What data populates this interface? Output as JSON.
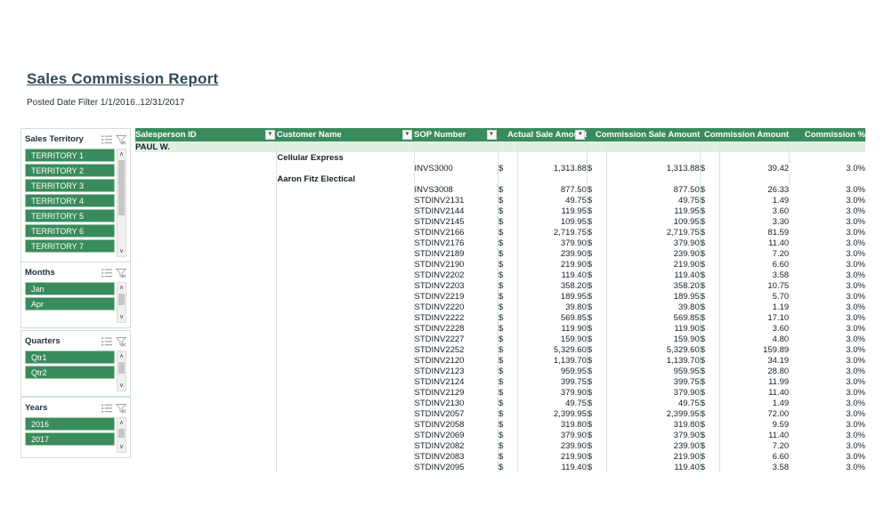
{
  "report": {
    "title": "Sales Commission Report",
    "subtitle": "Posted Date Filter 1/1/2016..12/31/2017"
  },
  "theme": {
    "accent_green": "#3a8b5c",
    "band_green": "#dff0e3",
    "title_color": "#2f4a5c"
  },
  "slicers": [
    {
      "title": "Sales Territory",
      "multiselect_icon": "multi-select-icon",
      "clear_filter_icon": "clear-filter-icon",
      "items": [
        "TERRITORY 1",
        "TERRITORY 2",
        "TERRITORY 3",
        "TERRITORY 4",
        "TERRITORY 5",
        "TERRITORY 6",
        "TERRITORY 7"
      ],
      "scroll_up": "∧",
      "scroll_down": "∨"
    },
    {
      "title": "Months",
      "multiselect_icon": "multi-select-icon",
      "clear_filter_icon": "clear-filter-icon",
      "items": [
        "Jan",
        "Apr"
      ],
      "scroll_up": "∧",
      "scroll_down": "∨"
    },
    {
      "title": "Quarters",
      "multiselect_icon": "multi-select-icon",
      "clear_filter_icon": "clear-filter-icon",
      "items": [
        "Qtr1",
        "Qtr2"
      ],
      "scroll_up": "∧",
      "scroll_down": "∨"
    },
    {
      "title": "Years",
      "multiselect_icon": "multi-select-icon",
      "clear_filter_icon": "clear-filter-icon",
      "items": [
        "2016",
        "2017"
      ],
      "scroll_up": "∧",
      "scroll_down": "∨"
    }
  ],
  "table": {
    "columns": [
      {
        "label": "Salesperson ID",
        "filter": true
      },
      {
        "label": "Customer Name",
        "filter": true
      },
      {
        "label": "SOP Number",
        "filter": true
      },
      {
        "label": "Actual Sale Amount",
        "filter": true
      },
      {
        "label": "Commission Sale Amount",
        "filter": false
      },
      {
        "label": "Commission Amount",
        "filter": false
      },
      {
        "label": "Commission %",
        "filter": false
      }
    ],
    "currency_symbol": "$",
    "salesperson": "PAUL W.",
    "groups": [
      {
        "customer": "Cellular Express",
        "rows": [
          {
            "sop": "INVS3000",
            "actual": "1,313.88",
            "commission_sale": "1,313.88",
            "commission_amount": "39.42",
            "commission_pct": "3.0%"
          }
        ]
      },
      {
        "customer": "Aaron Fitz Electical",
        "rows": [
          {
            "sop": "INVS3008",
            "actual": "877.50",
            "commission_sale": "877.50",
            "commission_amount": "26.33",
            "commission_pct": "3.0%"
          },
          {
            "sop": "STDINV2131",
            "actual": "49.75",
            "commission_sale": "49.75",
            "commission_amount": "1.49",
            "commission_pct": "3.0%"
          },
          {
            "sop": "STDINV2144",
            "actual": "119.95",
            "commission_sale": "119.95",
            "commission_amount": "3.60",
            "commission_pct": "3.0%"
          },
          {
            "sop": "STDINV2145",
            "actual": "109.95",
            "commission_sale": "109.95",
            "commission_amount": "3.30",
            "commission_pct": "3.0%"
          },
          {
            "sop": "STDINV2166",
            "actual": "2,719.75",
            "commission_sale": "2,719.75",
            "commission_amount": "81.59",
            "commission_pct": "3.0%"
          },
          {
            "sop": "STDINV2176",
            "actual": "379.90",
            "commission_sale": "379.90",
            "commission_amount": "11.40",
            "commission_pct": "3.0%"
          },
          {
            "sop": "STDINV2189",
            "actual": "239.90",
            "commission_sale": "239.90",
            "commission_amount": "7.20",
            "commission_pct": "3.0%"
          },
          {
            "sop": "STDINV2190",
            "actual": "219.90",
            "commission_sale": "219.90",
            "commission_amount": "6.60",
            "commission_pct": "3.0%"
          },
          {
            "sop": "STDINV2202",
            "actual": "119.40",
            "commission_sale": "119.40",
            "commission_amount": "3.58",
            "commission_pct": "3.0%"
          },
          {
            "sop": "STDINV2203",
            "actual": "358.20",
            "commission_sale": "358.20",
            "commission_amount": "10.75",
            "commission_pct": "3.0%"
          },
          {
            "sop": "STDINV2219",
            "actual": "189.95",
            "commission_sale": "189.95",
            "commission_amount": "5.70",
            "commission_pct": "3.0%"
          },
          {
            "sop": "STDINV2220",
            "actual": "39.80",
            "commission_sale": "39.80",
            "commission_amount": "1.19",
            "commission_pct": "3.0%"
          },
          {
            "sop": "STDINV2222",
            "actual": "569.85",
            "commission_sale": "569.85",
            "commission_amount": "17.10",
            "commission_pct": "3.0%"
          },
          {
            "sop": "STDINV2228",
            "actual": "119.90",
            "commission_sale": "119.90",
            "commission_amount": "3.60",
            "commission_pct": "3.0%"
          },
          {
            "sop": "STDINV2227",
            "actual": "159.90",
            "commission_sale": "159.90",
            "commission_amount": "4.80",
            "commission_pct": "3.0%"
          },
          {
            "sop": "STDINV2252",
            "actual": "5,329.60",
            "commission_sale": "5,329.60",
            "commission_amount": "159.89",
            "commission_pct": "3.0%"
          },
          {
            "sop": "STDINV2120",
            "actual": "1,139.70",
            "commission_sale": "1,139.70",
            "commission_amount": "34.19",
            "commission_pct": "3.0%"
          },
          {
            "sop": "STDINV2123",
            "actual": "959.95",
            "commission_sale": "959.95",
            "commission_amount": "28.80",
            "commission_pct": "3.0%"
          },
          {
            "sop": "STDINV2124",
            "actual": "399.75",
            "commission_sale": "399.75",
            "commission_amount": "11.99",
            "commission_pct": "3.0%"
          },
          {
            "sop": "STDINV2129",
            "actual": "379.90",
            "commission_sale": "379.90",
            "commission_amount": "11.40",
            "commission_pct": "3.0%"
          },
          {
            "sop": "STDINV2130",
            "actual": "49.75",
            "commission_sale": "49.75",
            "commission_amount": "1.49",
            "commission_pct": "3.0%"
          },
          {
            "sop": "STDINV2057",
            "actual": "2,399.95",
            "commission_sale": "2,399.95",
            "commission_amount": "72.00",
            "commission_pct": "3.0%"
          },
          {
            "sop": "STDINV2058",
            "actual": "319.80",
            "commission_sale": "319.80",
            "commission_amount": "9.59",
            "commission_pct": "3.0%"
          },
          {
            "sop": "STDINV2069",
            "actual": "379.90",
            "commission_sale": "379.90",
            "commission_amount": "11.40",
            "commission_pct": "3.0%"
          },
          {
            "sop": "STDINV2082",
            "actual": "239.90",
            "commission_sale": "239.90",
            "commission_amount": "7.20",
            "commission_pct": "3.0%"
          },
          {
            "sop": "STDINV2083",
            "actual": "219.90",
            "commission_sale": "219.90",
            "commission_amount": "6.60",
            "commission_pct": "3.0%"
          },
          {
            "sop": "STDINV2095",
            "actual": "119.40",
            "commission_sale": "119.40",
            "commission_amount": "3.58",
            "commission_pct": "3.0%"
          }
        ]
      }
    ]
  }
}
